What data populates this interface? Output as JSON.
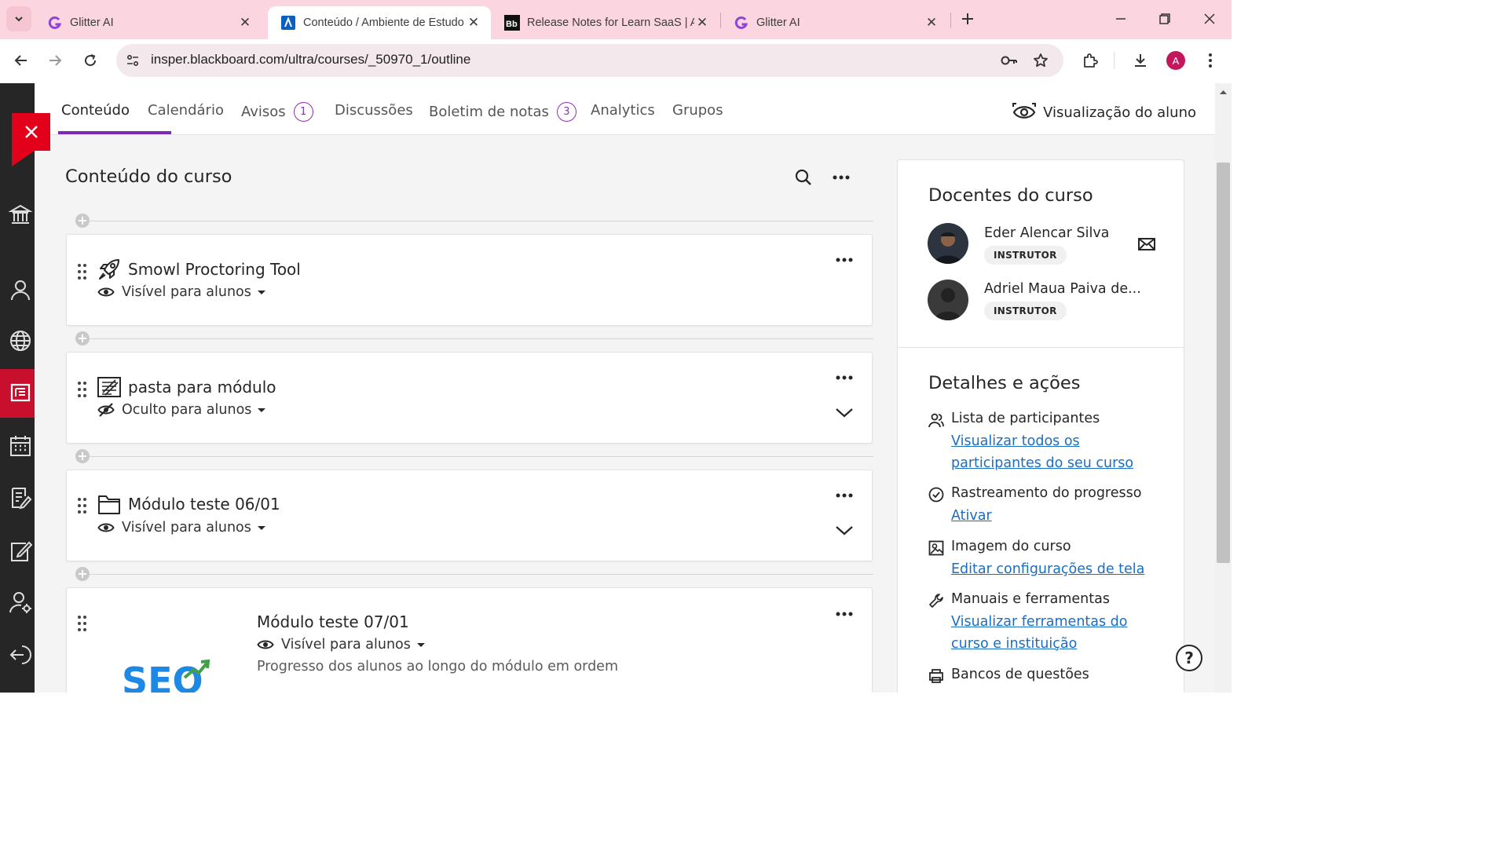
{
  "browser": {
    "tabs": [
      {
        "title": "Glitter AI",
        "favicon": "glitter-g-icon",
        "active": false
      },
      {
        "title": "Conteúdo / Ambiente de Estudo",
        "favicon": "anthology-icon",
        "active": true
      },
      {
        "title": "Release Notes for Learn SaaS | A",
        "favicon": "bb-icon",
        "active": false
      },
      {
        "title": "Glitter AI",
        "favicon": "glitter-g-icon",
        "active": false
      }
    ],
    "url": "insper.blackboard.com/ultra/courses/_50970_1/outline",
    "profile_initial": "A",
    "accent_color": "#fbd5df"
  },
  "course_nav": {
    "tabs": [
      {
        "label": "Conteúdo",
        "badge": null
      },
      {
        "label": "Calendário",
        "badge": null
      },
      {
        "label": "Avisos",
        "badge": "1"
      },
      {
        "label": "Discussões",
        "badge": null
      },
      {
        "label": "Boletim de notas",
        "badge": "3"
      },
      {
        "label": "Analytics",
        "badge": null
      },
      {
        "label": "Grupos",
        "badge": null
      }
    ],
    "active_tab": "Conteúdo",
    "student_view_label": "Visualização do aluno"
  },
  "content": {
    "heading": "Conteúdo do curso",
    "items": [
      {
        "title": "Smowl Proctoring Tool",
        "icon": "rocket-icon",
        "visibility": "Visível para alunos",
        "expandable": false
      },
      {
        "title": "pasta para módulo",
        "icon": "learning-module-icon",
        "visibility": "Oculto para alunos",
        "expandable": true
      },
      {
        "title": "Módulo teste 06/01",
        "icon": "folder-icon",
        "visibility": "Visível para alunos",
        "expandable": true
      },
      {
        "title": "Módulo teste 07/01",
        "icon": "seo-image",
        "visibility": "Visível para alunos",
        "description": "Progresso dos alunos ao longo do módulo em ordem",
        "image_text": "SEO"
      }
    ]
  },
  "sidebar": {
    "instructors_heading": "Docentes do curso",
    "instructors": [
      {
        "name": "Eder Alencar Silva",
        "role": "INSTRUTOR"
      },
      {
        "name": "Adriel Maua Paiva de...",
        "role": "INSTRUTOR"
      }
    ],
    "details_heading": "Detalhes e ações",
    "details": [
      {
        "label": "Lista de participantes",
        "link": "Visualizar todos os participantes do seu curso",
        "icon": "participants-icon"
      },
      {
        "label": "Rastreamento do progresso",
        "link": "Ativar",
        "icon": "check-circle-icon"
      },
      {
        "label": "Imagem do curso",
        "link": "Editar configurações de tela",
        "icon": "image-icon"
      },
      {
        "label": "Manuais e ferramentas",
        "link": "Visualizar ferramentas do curso e instituição",
        "icon": "wrench-icon"
      },
      {
        "label": "Bancos de questões",
        "link": "",
        "icon": "printer-icon"
      }
    ]
  },
  "colors": {
    "primary_purple": "#7b2ab4",
    "link_blue": "#1a6ec1",
    "close_red": "#e2001a",
    "nav_dark": "#262626"
  }
}
